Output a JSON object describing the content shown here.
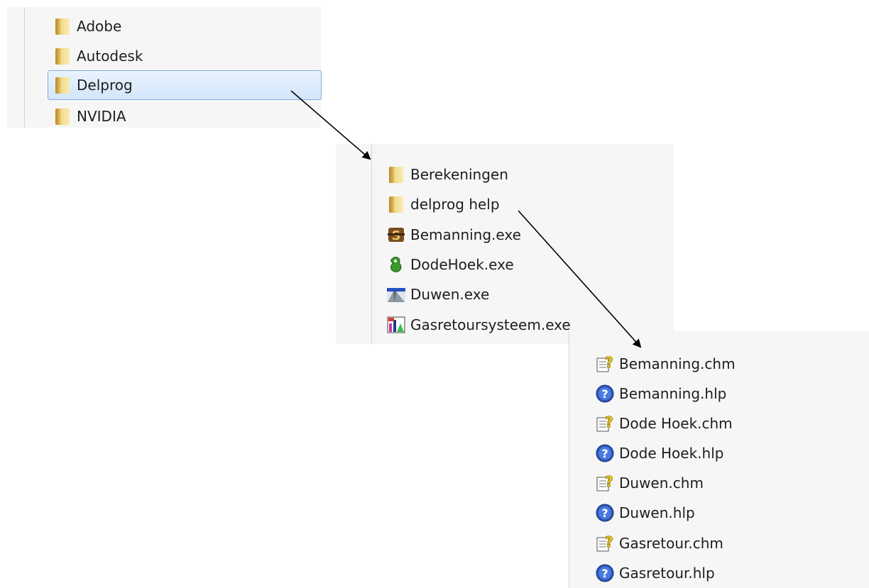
{
  "panel1": {
    "items": [
      {
        "label": "Adobe",
        "icon": "folder-icon"
      },
      {
        "label": "Autodesk",
        "icon": "folder-icon"
      },
      {
        "label": "Delprog",
        "icon": "folder-icon",
        "selected": true
      },
      {
        "label": "NVIDIA",
        "icon": "folder-icon"
      }
    ]
  },
  "panel2": {
    "items": [
      {
        "label": "Berekeningen",
        "icon": "folder-icon"
      },
      {
        "label": "delprog help",
        "icon": "folder-icon"
      },
      {
        "label": "Bemanning.exe",
        "icon": "bemanning-app-icon"
      },
      {
        "label": "DodeHoek.exe",
        "icon": "dodehoek-app-icon"
      },
      {
        "label": "Duwen.exe",
        "icon": "duwen-app-icon"
      },
      {
        "label": "Gasretoursysteem.exe",
        "icon": "gasretour-app-icon"
      }
    ]
  },
  "panel3": {
    "items": [
      {
        "label": "Bemanning.chm",
        "icon": "chm-help-icon"
      },
      {
        "label": "Bemanning.hlp",
        "icon": "hlp-help-icon"
      },
      {
        "label": "Dode Hoek.chm",
        "icon": "chm-help-icon"
      },
      {
        "label": "Dode Hoek.hlp",
        "icon": "hlp-help-icon"
      },
      {
        "label": "Duwen.chm",
        "icon": "chm-help-icon"
      },
      {
        "label": "Duwen.hlp",
        "icon": "hlp-help-icon"
      },
      {
        "label": "Gasretour.chm",
        "icon": "chm-help-icon"
      },
      {
        "label": "Gasretour.hlp",
        "icon": "hlp-help-icon"
      }
    ]
  },
  "colors": {
    "selection_fill": "#dbeafc",
    "selection_border": "#84acdd",
    "panel_background": "#f6f6f6",
    "arrow": "#000000"
  }
}
